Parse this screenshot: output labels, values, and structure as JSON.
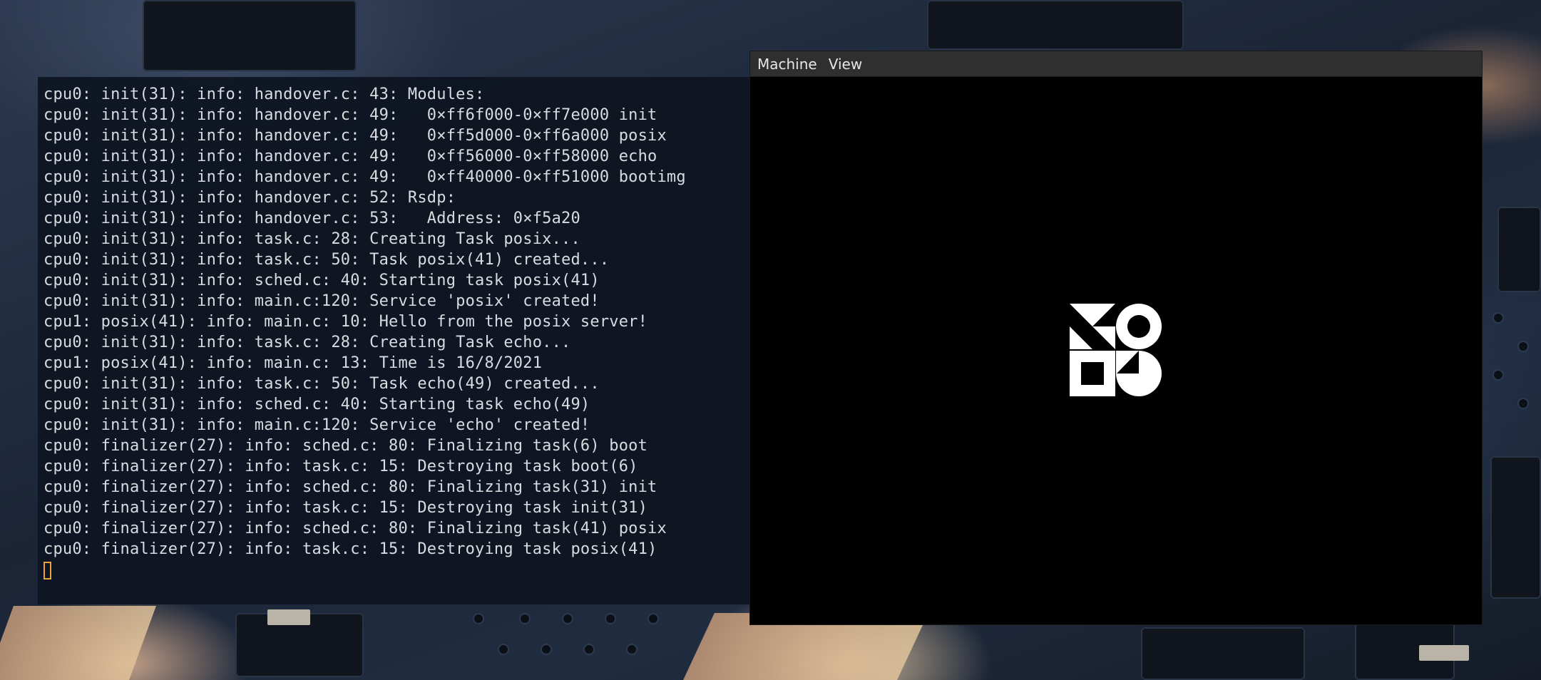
{
  "terminal": {
    "lines": [
      "cpu0: init(31): info: handover.c: 43: Modules:",
      "cpu0: init(31): info: handover.c: 49:   0×ff6f000-0×ff7e000 init",
      "cpu0: init(31): info: handover.c: 49:   0×ff5d000-0×ff6a000 posix",
      "cpu0: init(31): info: handover.c: 49:   0×ff56000-0×ff58000 echo",
      "cpu0: init(31): info: handover.c: 49:   0×ff40000-0×ff51000 bootimg",
      "cpu0: init(31): info: handover.c: 52: Rsdp:",
      "cpu0: init(31): info: handover.c: 53:   Address: 0×f5a20",
      "cpu0: init(31): info: task.c: 28: Creating Task posix...",
      "cpu0: init(31): info: task.c: 50: Task posix(41) created...",
      "cpu0: init(31): info: sched.c: 40: Starting task posix(41)",
      "cpu0: init(31): info: main.c:120: Service 'posix' created!",
      "cpu1: posix(41): info: main.c: 10: Hello from the posix server!",
      "cpu0: init(31): info: task.c: 28: Creating Task echo...",
      "cpu1: posix(41): info: main.c: 13: Time is 16/8/2021",
      "cpu0: init(31): info: task.c: 50: Task echo(49) created...",
      "cpu0: init(31): info: sched.c: 40: Starting task echo(49)",
      "cpu0: init(31): info: main.c:120: Service 'echo' created!",
      "cpu0: finalizer(27): info: sched.c: 80: Finalizing task(6) boot",
      "cpu0: finalizer(27): info: task.c: 15: Destroying task boot(6)",
      "cpu0: finalizer(27): info: sched.c: 80: Finalizing task(31) init",
      "cpu0: finalizer(27): info: task.c: 15: Destroying task init(31)",
      "cpu0: finalizer(27): info: sched.c: 80: Finalizing task(41) posix",
      "cpu0: finalizer(27): info: task.c: 15: Destroying task posix(41)"
    ],
    "cursor_color": "#e8a33a"
  },
  "vm_window": {
    "menu": [
      {
        "label": "Machine"
      },
      {
        "label": "View"
      }
    ],
    "screen_logo_icon": "os-logo-icon"
  }
}
